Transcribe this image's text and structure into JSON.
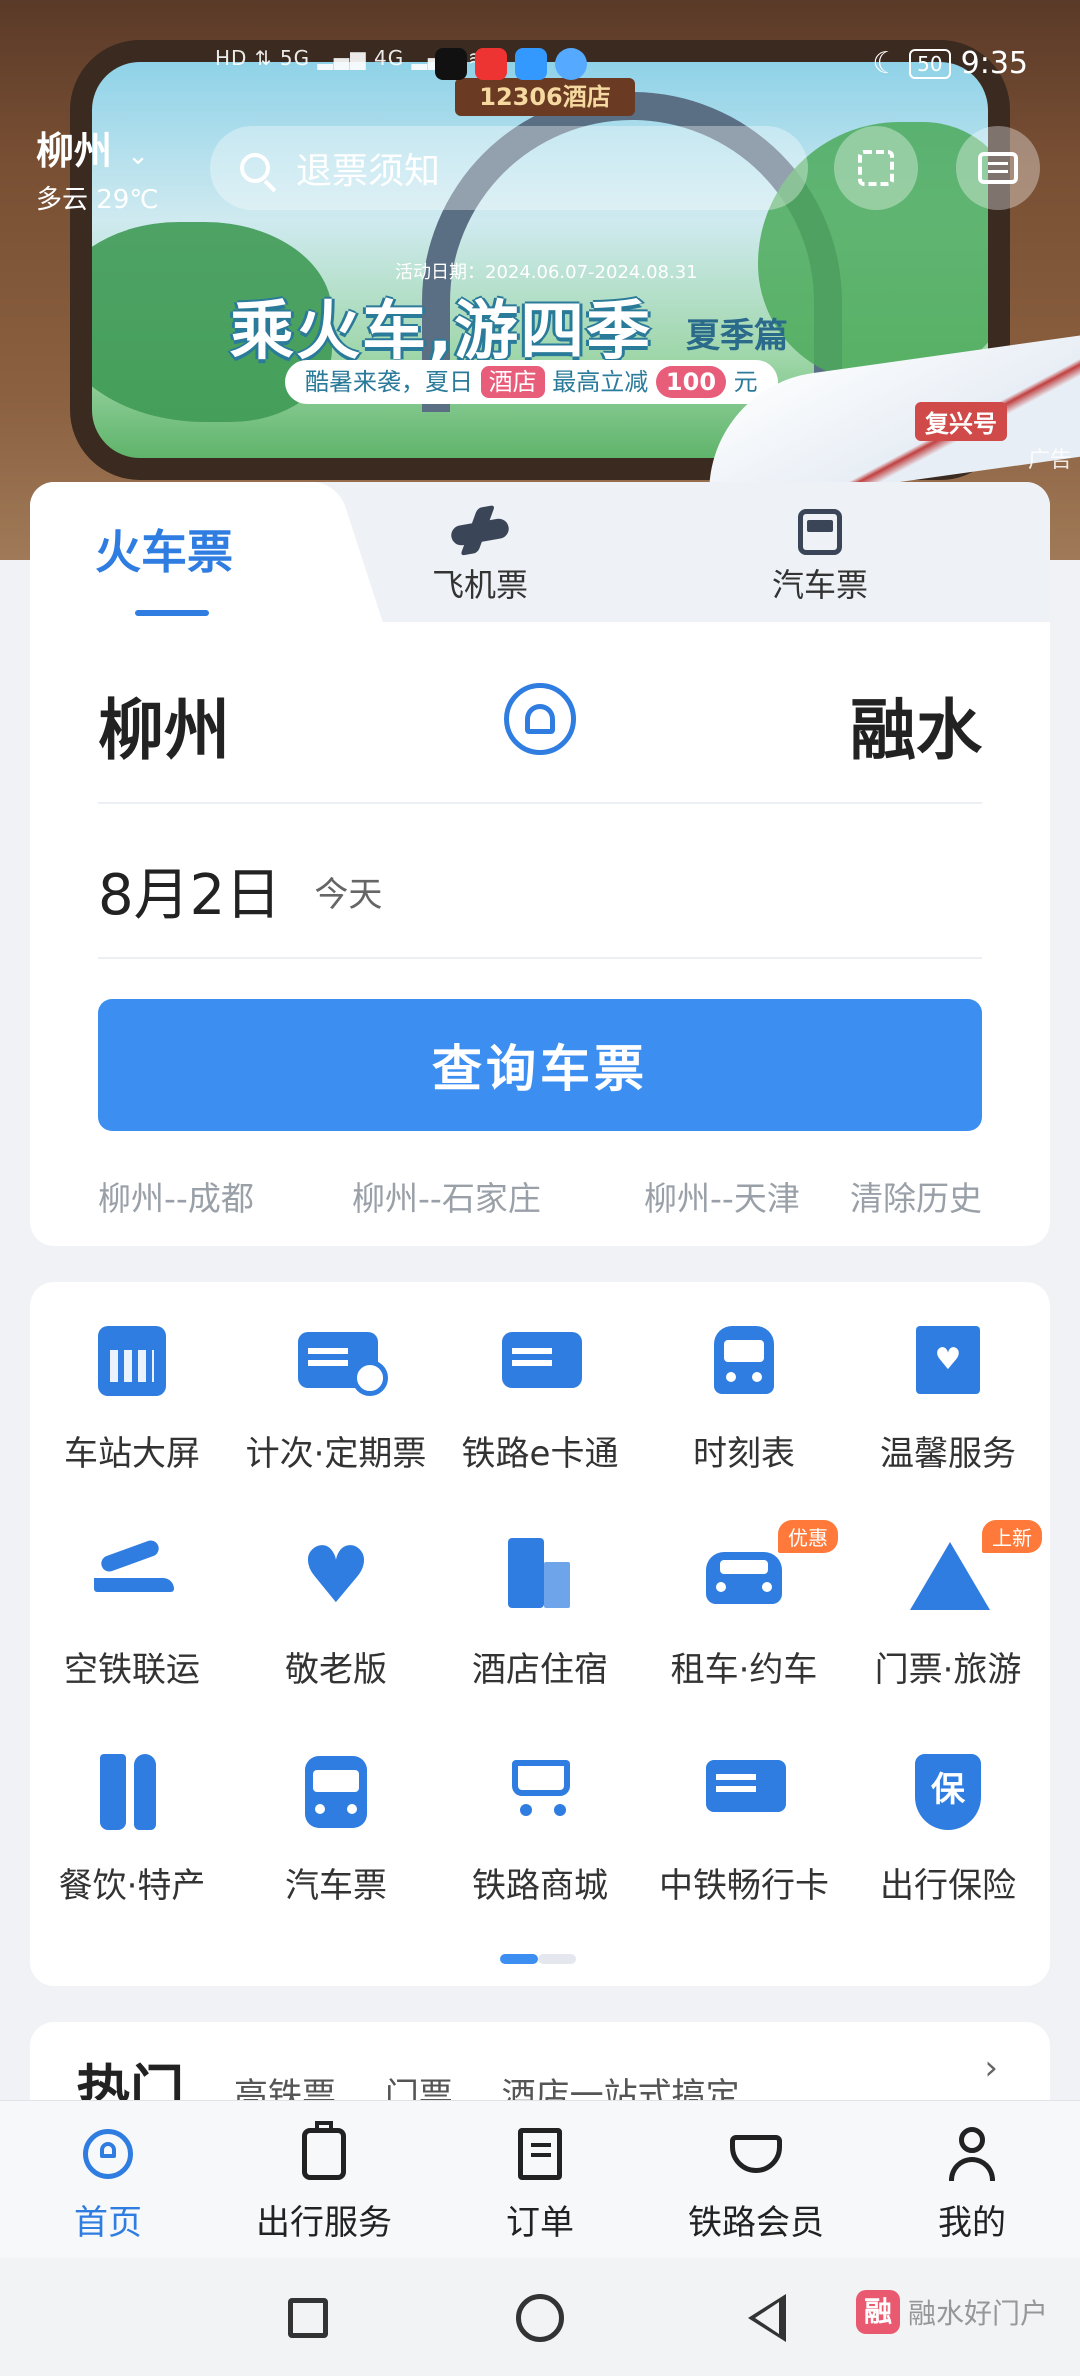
{
  "status_bar": {
    "network": "HD ⇅ 5G ▂▄▆ 4G ▂▄▆ ≋",
    "battery": "50",
    "time": "9:35"
  },
  "banner": {
    "hotel_sign": "12306酒店",
    "activity_date": "活动日期：2024.06.07-2024.08.31",
    "title": "乘火车,游四季",
    "subtitle": "夏季篇",
    "promo_prefix": "酷暑来袭，夏日",
    "promo_tag": "酒店",
    "promo_mid": "最高立减",
    "promo_amount": "100",
    "promo_unit": "元",
    "train_label": "复兴号",
    "ad_label": "广告"
  },
  "header": {
    "city": "柳州",
    "weather": "多云 29℃",
    "search_placeholder": "退票须知"
  },
  "ticket_tabs": [
    {
      "label": "火车票",
      "active": true
    },
    {
      "label": "飞机票",
      "icon": "plane-icon"
    },
    {
      "label": "汽车票",
      "icon": "bus-icon"
    }
  ],
  "booking": {
    "from": "柳州",
    "to": "融水",
    "date": "8月2日",
    "date_note": "今天",
    "query_button": "查询车票",
    "history": [
      "柳州--成都",
      "柳州--石家庄",
      "柳州--天津"
    ],
    "clear_history": "清除历史"
  },
  "services": [
    {
      "label": "车站大屏",
      "icon": "calendar-icon"
    },
    {
      "label": "计次·定期票",
      "icon": "ticket-clock-icon"
    },
    {
      "label": "铁路e卡通",
      "icon": "rail-card-icon"
    },
    {
      "label": "时刻表",
      "icon": "train-icon"
    },
    {
      "label": "温馨服务",
      "icon": "heart-bag-icon"
    },
    {
      "label": "空铁联运",
      "icon": "air-rail-icon"
    },
    {
      "label": "敬老版",
      "icon": "heart-icon"
    },
    {
      "label": "酒店住宿",
      "icon": "hotel-icon"
    },
    {
      "label": "租车·约车",
      "icon": "car-icon",
      "badge": "优惠"
    },
    {
      "label": "门票·旅游",
      "icon": "mountain-icon",
      "badge": "上新"
    },
    {
      "label": "餐饮·特产",
      "icon": "fork-knife-icon"
    },
    {
      "label": "汽车票",
      "icon": "bus-icon"
    },
    {
      "label": "铁路商城",
      "icon": "cart-icon"
    },
    {
      "label": "中铁畅行卡",
      "icon": "card-train-icon"
    },
    {
      "label": "出行保险",
      "icon": "shield-icon",
      "glyph": "保"
    }
  ],
  "hot": {
    "title": "热门",
    "tags": [
      "高铁票",
      "门票",
      "酒店一站式搞定"
    ]
  },
  "tabbar": [
    {
      "label": "首页",
      "active": true
    },
    {
      "label": "出行服务"
    },
    {
      "label": "订单"
    },
    {
      "label": "铁路会员"
    },
    {
      "label": "我的"
    }
  ],
  "watermark": {
    "logo": "融",
    "text": "融水好门户"
  },
  "colors": {
    "accent": "#2f7de1",
    "button": "#3c8ff0",
    "badge": "#ff7a3a"
  }
}
